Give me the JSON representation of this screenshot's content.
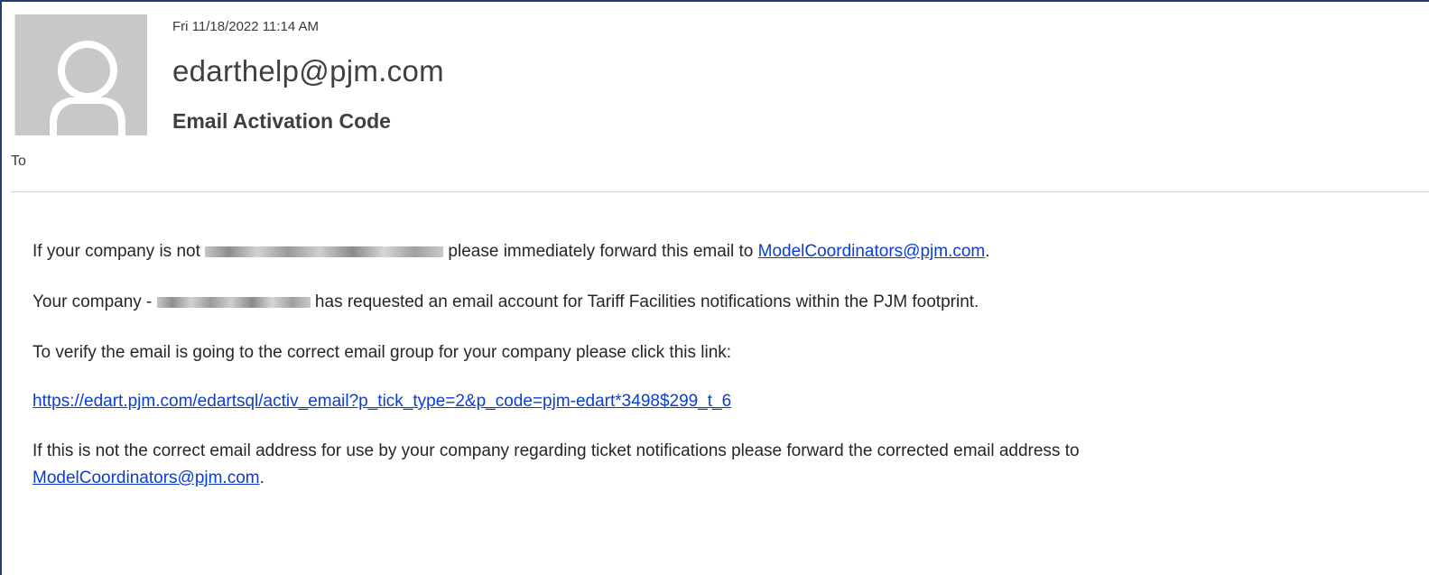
{
  "header": {
    "date": "Fri 11/18/2022 11:14 AM",
    "sender": "edarthelp@pjm.com",
    "subject": "Email Activation Code",
    "to_label": "To"
  },
  "body": {
    "p1_before": "If your company is not ",
    "p1_after": " please immediately forward this email to ",
    "p1_link": "ModelCoordinators@pjm.com",
    "p1_end": ".",
    "p2_before": "Your company - ",
    "p2_after": " has requested an email account for Tariff Facilities notifications within the PJM footprint.",
    "p3": "To verify the email is going to the correct email group for your company please click this link:",
    "activation_link": "https://edart.pjm.com/edartsql/activ_email?p_tick_type=2&p_code=pjm-edart*3498$299_t_6",
    "p5_line1": "If this is not the correct email address for use by your company regarding ticket notifications please forward the corrected email address to",
    "p5_link": "ModelCoordinators@pjm.com",
    "p5_end": "."
  },
  "icons": {
    "avatar": "person-silhouette-icon"
  },
  "colors": {
    "link": "#0b3ecf",
    "frame": "#1f3f6e",
    "avatar_bg": "#c8c8c8"
  }
}
